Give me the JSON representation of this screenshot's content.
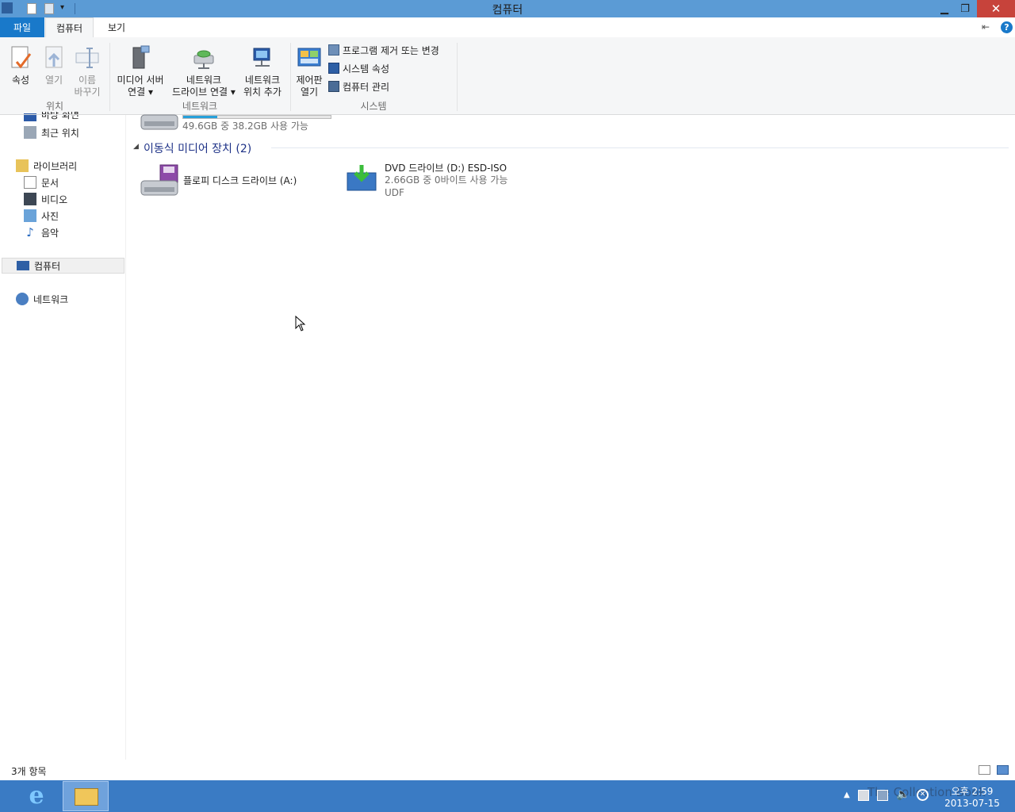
{
  "window": {
    "title": "컴퓨터",
    "minimize_glyph": "▁",
    "restore_glyph": "❐",
    "close_glyph": "✕"
  },
  "tabs": {
    "file": "파일",
    "computer": "컴퓨터",
    "view": "보기"
  },
  "ribbon": {
    "location_group": {
      "label": "위치",
      "properties": "속성",
      "open": "열기",
      "rename_line1": "이름",
      "rename_line2": "바꾸기"
    },
    "network_group": {
      "label": "네트워크",
      "media_line1": "미디어 서버",
      "media_line2": "연결",
      "map_line1": "네트워크",
      "map_line2": "드라이브 연결",
      "add_line1": "네트워크",
      "add_line2": "위치 추가"
    },
    "system_group": {
      "label": "시스템",
      "cp_line1": "제어판",
      "cp_line2": "열기",
      "uninstall": "프로그램 제거 또는 변경",
      "sys_props": "시스템 속성",
      "manage": "컴퓨터 관리"
    }
  },
  "nav": {
    "desktop_partial": "바탕 화면",
    "recent": "최근 위치",
    "libraries": "라이브러리",
    "documents": "문서",
    "videos": "비디오",
    "pictures": "사진",
    "music": "음악",
    "computer": "컴퓨터",
    "network": "네트워크"
  },
  "content": {
    "local_disk_sub": "49.6GB 중 38.2GB 사용 가능",
    "local_disk_usage_fraction": 0.23,
    "removable_header": "이동식 미디어 장치 (2)",
    "floppy_name": "플로피 디스크 드라이브 (A:)",
    "dvd_name": "DVD 드라이브 (D:) ESD-ISO",
    "dvd_sub1": "2.66GB 중 0바이트 사용 가능",
    "dvd_sub2": "UDF"
  },
  "status": {
    "items": "3개 항목"
  },
  "taskbar": {
    "time": "오후 2:59",
    "date": "2013-07-15",
    "watermark": "The Collection Book"
  },
  "colors": {
    "titlebar": "#5b9bd5",
    "file_tab": "#1979ca",
    "close": "#c7433b",
    "taskbar": "#3a7bc4",
    "group_header": "#1e3287"
  }
}
